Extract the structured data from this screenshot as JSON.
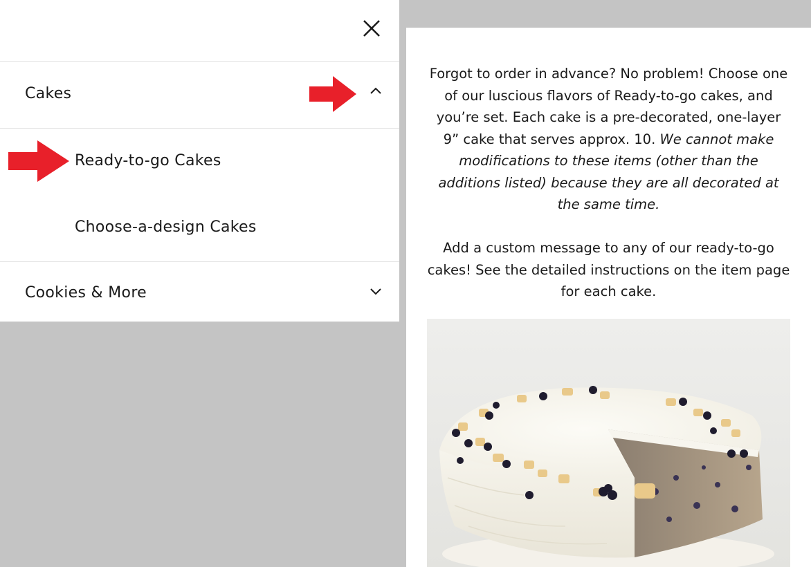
{
  "menu": {
    "close_icon": "close-icon",
    "categories": [
      {
        "label": "Cakes",
        "expanded": true,
        "chevron_icon": "chevron-up-icon",
        "items": [
          "Ready-to-go Cakes",
          "Choose-a-design Cakes"
        ]
      },
      {
        "label": "Cookies & More",
        "expanded": false,
        "chevron_icon": "chevron-down-icon"
      }
    ]
  },
  "annotations": {
    "arrow_color": "#e8202a",
    "arrow_icon": "red-arrow-right-icon"
  },
  "content": {
    "paragraph1_normal": "Forgot to order in advance? No problem! Choose one of our luscious flavors of Ready-to-go cakes, and you’re set. Each cake is a pre-decorated, one-layer 9” cake that serves approx. 10. ",
    "paragraph1_italic": "We cannot make modifications to these items (other than the additions listed) because they are all decorated at the same time.",
    "paragraph2": "Add a custom message to any of our ready-to-go cakes! See the detailed instructions on the item page for each cake.",
    "image_subject": "cake-photo"
  }
}
